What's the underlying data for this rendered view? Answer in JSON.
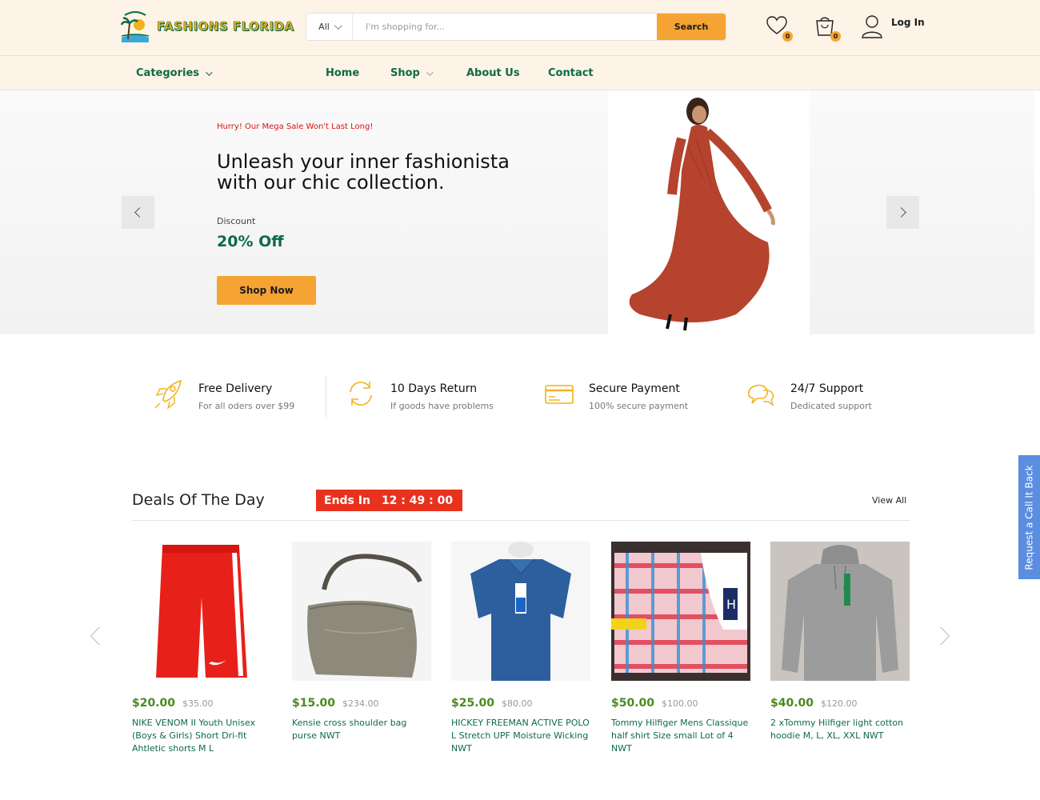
{
  "header": {
    "logo_text": "FASHIONS FLORIDA",
    "search": {
      "category": "All",
      "placeholder": "I'm shopping for...",
      "button": "Search"
    },
    "wishlist_count": "0",
    "cart_count": "0",
    "login_label": "Log In"
  },
  "nav": {
    "categories": "Categories",
    "items": [
      "Home",
      "Shop",
      "About Us",
      "Contact"
    ]
  },
  "hero": {
    "tagline": "Hurry! Our Mega Sale Won't Last Long!",
    "title": "Unleash your inner fashionista with our chic collection.",
    "discount_label": "Discount",
    "discount_value": "20% Off",
    "cta": "Shop Now"
  },
  "features": [
    {
      "title": "Free Delivery",
      "subtitle": "For all oders over $99",
      "icon": "rocket-icon"
    },
    {
      "title": "10 Days Return",
      "subtitle": "If goods have problems",
      "icon": "refresh-icon"
    },
    {
      "title": "Secure Payment",
      "subtitle": "100% secure payment",
      "icon": "credit-card-icon"
    },
    {
      "title": "24/7 Support",
      "subtitle": "Dedicated support",
      "icon": "chat-icon"
    }
  ],
  "deals": {
    "title": "Deals Of The Day",
    "ends_label": "Ends In",
    "timer": "12 : 49 : 00",
    "view_all": "View All",
    "products": [
      {
        "price": "$20.00",
        "old_price": "$35.00",
        "name": "NIKE VENOM II Youth Unisex (Boys & Girls) Short Dri-fit Ahtletic shorts M L"
      },
      {
        "price": "$15.00",
        "old_price": "$234.00",
        "name": "Kensie cross shoulder bag purse NWT"
      },
      {
        "price": "$25.00",
        "old_price": "$80.00",
        "name": "HICKEY FREEMAN ACTIVE POLO L Stretch UPF Moisture Wicking NWT"
      },
      {
        "price": "$50.00",
        "old_price": "$100.00",
        "name": "Tommy Hilfiger Mens Classique half shirt Size small Lot of 4 NWT"
      },
      {
        "price": "$40.00",
        "old_price": "$120.00",
        "name": "2 xTommy Hilfiger light cotton hoodie M, L, XL, XXL NWT"
      }
    ]
  },
  "callback": "Request a Call It Back",
  "colors": {
    "accent": "#f5a433",
    "brand_green": "#0d6b45",
    "price_green": "#4a8a1f",
    "timer_red": "#e8321e",
    "header_bg": "#fdf3e7"
  }
}
